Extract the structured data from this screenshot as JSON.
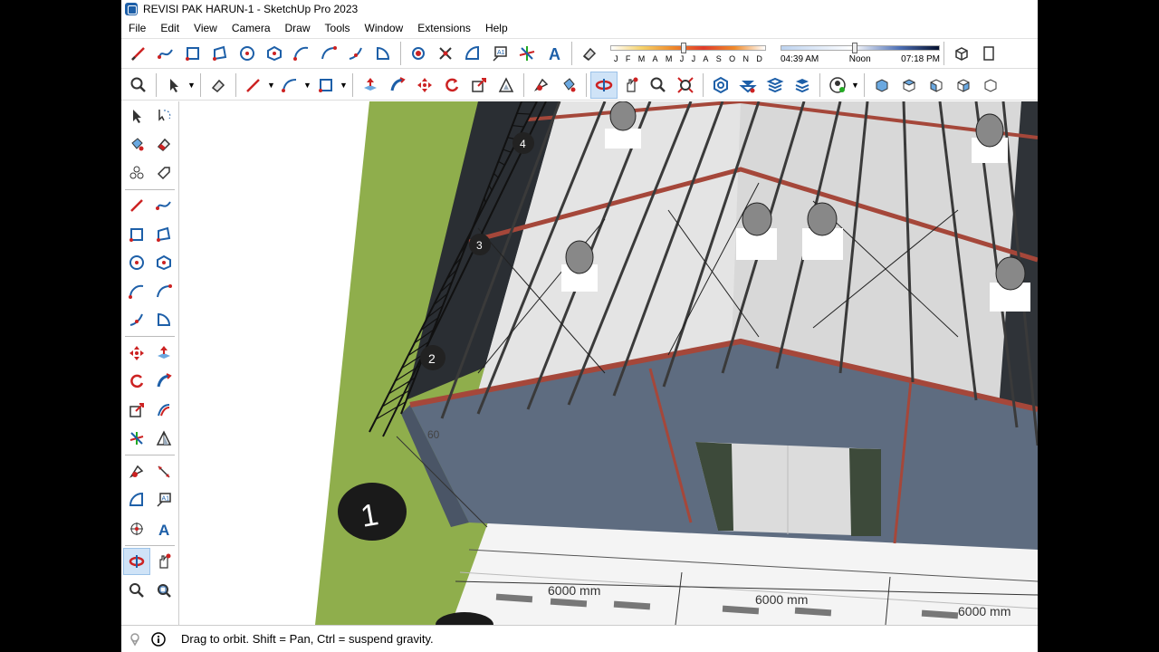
{
  "window": {
    "title": "REVISI PAK HARUN-1 - SketchUp Pro 2023"
  },
  "menu": [
    "File",
    "Edit",
    "View",
    "Camera",
    "Draw",
    "Tools",
    "Window",
    "Extensions",
    "Help"
  ],
  "shadow": {
    "months": [
      "J",
      "F",
      "M",
      "A",
      "M",
      "J",
      "J",
      "A",
      "S",
      "O",
      "N",
      "D"
    ],
    "month_position": 0.45,
    "time_start": "04:39 AM",
    "time_mid": "Noon",
    "time_end": "07:18 PM",
    "time_position": 0.45
  },
  "toolbar_top": [
    "pencil-icon",
    "freehand-icon",
    "rectangle-icon",
    "rotated-rectangle-icon",
    "circle-icon",
    "polygon-icon",
    "arc-icon",
    "two-point-arc-icon",
    "three-point-arc-icon",
    "pie-icon",
    "position-camera-icon",
    "walk-icon",
    "protractor-icon",
    "text-icon",
    "axes-icon",
    "3d-text-icon",
    "eraser-icon"
  ],
  "toolbar_second": [
    "zoom-icon",
    "select-icon",
    "eraser-icon",
    "line-icon",
    "arc-icon",
    "rectangle-icon",
    "push-pull-icon",
    "follow-me-icon",
    "move-icon",
    "rotate-icon",
    "scale-icon",
    "offset-icon",
    "tape-measure-icon",
    "paint-bucket-icon",
    "orbit-icon",
    "pan-icon",
    "zoom-icon",
    "zoom-extents-icon",
    "components-icon",
    "materials-icon",
    "styles-icon",
    "layers-icon",
    "user-icon",
    "iso-view-icon",
    "top-view-icon",
    "front-view-icon",
    "right-view-icon",
    "back-view-icon"
  ],
  "left_toolbar": [
    "select-icon",
    "lasso-icon",
    "paint-bucket-icon",
    "eraser-icon",
    "component-icon",
    "tag-icon",
    "line-icon",
    "freehand-icon",
    "rectangle-icon",
    "rotated-rectangle-icon",
    "circle-icon",
    "polygon-icon",
    "arc-icon",
    "two-point-arc-icon",
    "three-point-arc-icon",
    "pie-icon",
    "move-icon",
    "push-pull-icon",
    "rotate-icon",
    "follow-me-icon",
    "scale-icon",
    "offset-icon",
    "axes-icon",
    "section-icon",
    "tape-measure-icon",
    "dimension-icon",
    "protractor-icon",
    "text-icon",
    "3d-axes-icon",
    "3d-text-icon",
    "orbit-icon",
    "pan-icon",
    "zoom-icon",
    "zoom-window-icon"
  ],
  "viewport": {
    "dimensions": [
      "6000 mm",
      "6000 mm",
      "6000 mm"
    ],
    "grid_bubbles": [
      "1",
      "2",
      "3",
      "4"
    ],
    "partial_label": "60"
  },
  "status": {
    "text": "Drag to orbit. Shift = Pan, Ctrl = suspend gravity."
  },
  "colors": {
    "accent": "#1d5fa8",
    "ground": "#8fae4c",
    "roof": "#d9d9d9",
    "wall": "#5e6c80",
    "beam": "#a5473a"
  }
}
